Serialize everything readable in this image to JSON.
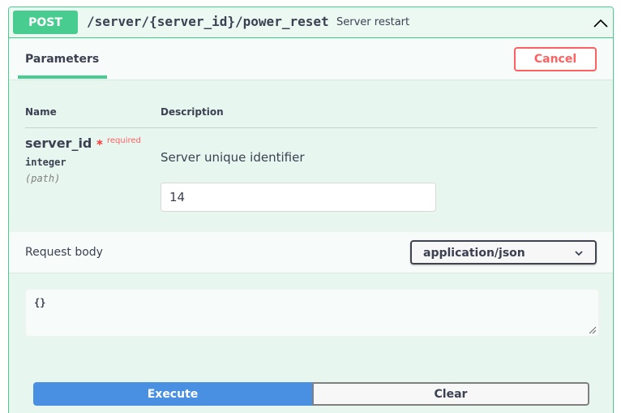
{
  "operation": {
    "method": "POST",
    "path": "/server/{server_id}/power_reset",
    "summary": "Server restart",
    "color": "#49cc90"
  },
  "params_section": {
    "tab_label": "Parameters",
    "cancel_label": "Cancel",
    "col_name": "Name",
    "col_description": "Description"
  },
  "parameter": {
    "name": "server_id",
    "required_star": "*",
    "required_label": "required",
    "type": "integer",
    "in": "(path)",
    "description": "Server unique identifier",
    "value": "14"
  },
  "request_body": {
    "label": "Request body",
    "content_type": "application/json",
    "example": "{}"
  },
  "actions": {
    "execute_label": "Execute",
    "clear_label": "Clear"
  },
  "icons": {
    "collapse": "chevron-up-icon",
    "dropdown": "chevron-down-icon"
  }
}
